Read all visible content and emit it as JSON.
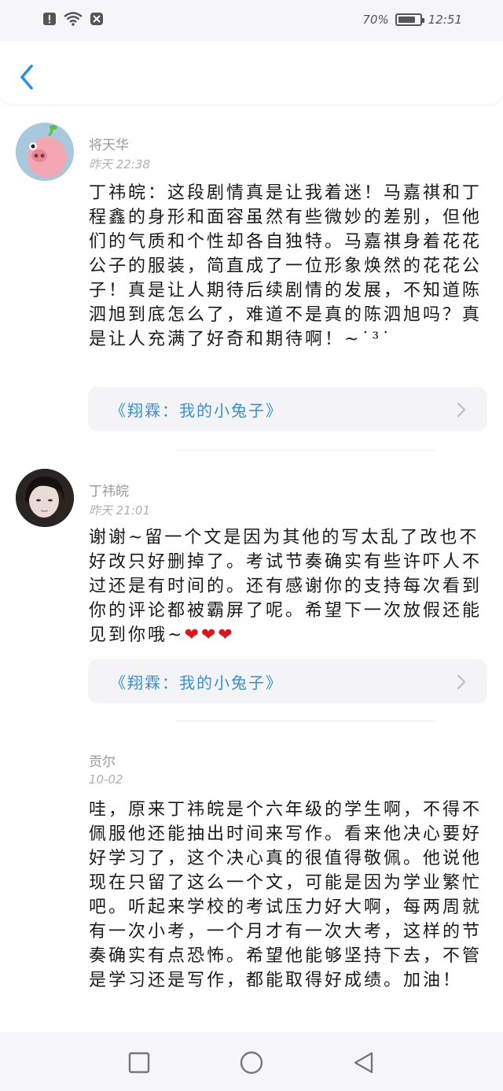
{
  "status_bar": {
    "battery": "70%",
    "battery_level": 0.7,
    "time": "12:51",
    "icons": [
      "alert-icon",
      "wifi-icon",
      "app-icon"
    ]
  },
  "header": {
    "back_icon": "chevron-left-icon"
  },
  "comments": [
    {
      "username": "将天华",
      "time": "昨天 22:38",
      "text": "丁祎皖：这段剧情真是让我着迷！马嘉祺和丁程鑫的身形和面容虽然有些微妙的差别，但他们的气质和个性却各自独特。马嘉祺身着花花公子的服装，简直成了一位形象焕然的花花公子！真是让人期待后续剧情的发展，不知道陈泗旭到底怎么了，难道不是真的陈泗旭吗？真是让人充满了好奇和期待啊！~˙³˙",
      "book": "《翔霖：我的小兔子》"
    },
    {
      "username": "丁祎皖",
      "time": "昨天 21:01",
      "text": "谢谢~留一个文是因为其他的写太乱了改也不好改只好删掉了。考试节奏确实有些许吓人不过还是有时间的。还有感谢你的支持每次看到你的评论都被霸屏了呢。希望下一次放假还能见到你哦~",
      "hearts": "❤❤❤",
      "book": "《翔霖：我的小兔子》"
    },
    {
      "username": "贡尔",
      "time": "10-02",
      "text": "哇，原来丁祎皖是个六年级的学生啊，不得不佩服他还能抽出时间来写作。看来他决心要好好学习了，这个决心真的很值得敬佩。他说他现在只留了这么一个文，可能是因为学业繁忙吧。听起来学校的考试压力好大啊，每两周就有一次小考，一个月才有一次大考，这样的节奏确实有点恐怖。希望他能够坚持下去，不管是学习还是写作，都能取得好成绩。加油！"
    }
  ],
  "nav": {
    "icons": [
      "square-icon",
      "circle-icon",
      "triangle-back-icon"
    ]
  },
  "colors": {
    "link": "#3a8fd0",
    "back_arrow": "#2a8ee8",
    "heart": "#d6191e"
  }
}
